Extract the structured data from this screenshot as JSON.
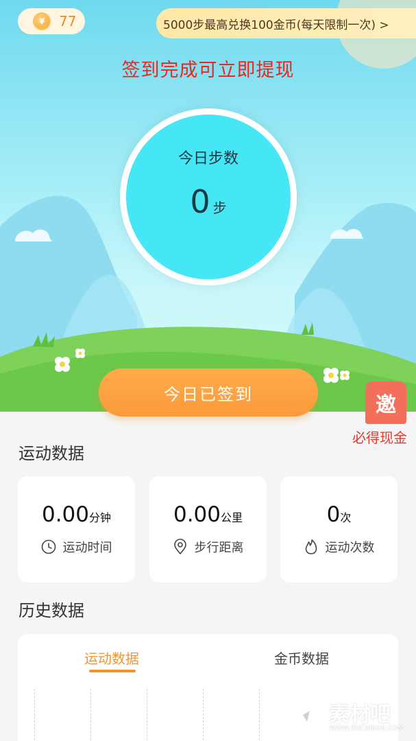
{
  "header": {
    "coin_symbol": "¥",
    "coin_count": "77",
    "exchange_banner": "5000步最高兑换100金币(每天限制一次) >"
  },
  "signin_tip": "签到完成可立即提现",
  "steps": {
    "title": "今日步数",
    "value": "0",
    "unit": "步"
  },
  "signin_button": "今日已签到",
  "invite": {
    "badge": "邀",
    "label": "必得现金"
  },
  "sports_section": {
    "title": "运动数据",
    "cards": [
      {
        "value": "0.00",
        "unit": "分钟",
        "label": "运动时间",
        "icon": "clock-icon"
      },
      {
        "value": "0.00",
        "unit": "公里",
        "label": "步行距离",
        "icon": "location-pin-icon"
      },
      {
        "value": "0",
        "unit": "次",
        "label": "运动次数",
        "icon": "flame-icon"
      }
    ]
  },
  "history_section": {
    "title": "历史数据",
    "tabs": [
      {
        "label": "运动数据",
        "active": true
      },
      {
        "label": "金币数据",
        "active": false
      }
    ]
  },
  "watermark": {
    "title": "素材吧",
    "url": "WWW.SUCAIBAR.COM"
  },
  "colors": {
    "accent": "#fb9a3a",
    "tip_red": "#e8281f",
    "step_circle": "#46e7f5",
    "invite_badge": "#f36f5b"
  }
}
